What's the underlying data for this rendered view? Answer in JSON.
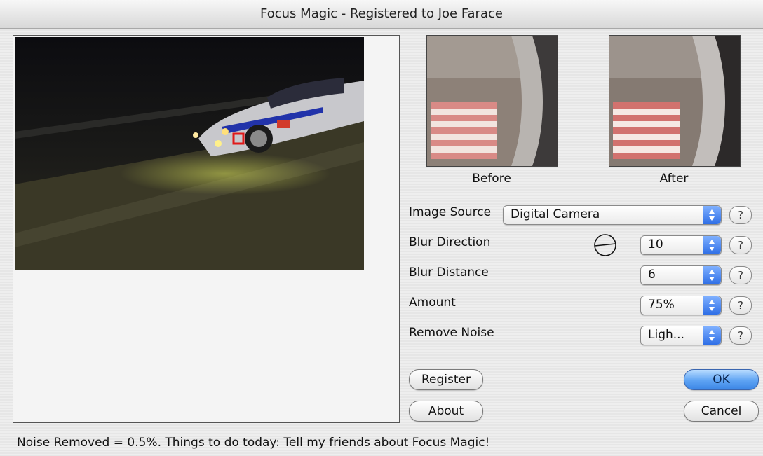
{
  "window": {
    "title": "Focus Magic - Registered to Joe Farace"
  },
  "previews": {
    "before_label": "Before",
    "after_label": "After"
  },
  "fields": [
    {
      "label": "Image Source",
      "value": "Digital Camera"
    },
    {
      "label": "Blur Direction",
      "value": "10"
    },
    {
      "label": "Blur Distance",
      "value": "6"
    },
    {
      "label": "Amount",
      "value": "75%"
    },
    {
      "label": "Remove Noise",
      "value": "Ligh..."
    }
  ],
  "help_label": "?",
  "buttons": {
    "register": "Register",
    "about": "About",
    "ok": "OK",
    "cancel": "Cancel"
  },
  "status": "Noise Removed = 0.5%. Things to do today: Tell my friends about Focus Magic!",
  "colors": {
    "default_button": "#5ea3f3",
    "popup_arrow": "#2e6ee6"
  }
}
